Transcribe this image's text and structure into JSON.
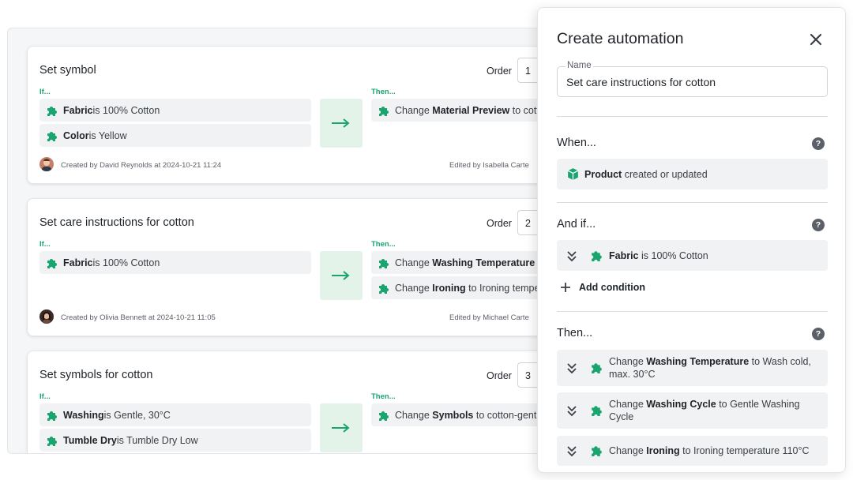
{
  "rules": [
    {
      "title": "Set symbol",
      "order_label": "Order",
      "order_value": "1",
      "if_label": "If...",
      "then_label": "Then...",
      "conditions": [
        {
          "bold": "Fabric",
          "text": " is 100% Cotton"
        },
        {
          "bold": "Color",
          "text": " is Yellow"
        }
      ],
      "actions": [
        {
          "pre": "Change ",
          "bold": "Material Preview",
          "post": " to cotto"
        }
      ],
      "created": "Created by David Reynolds at 2024-10-21 11:24",
      "edited": "Edited by Isabella Carte"
    },
    {
      "title": "Set care instructions for cotton",
      "order_label": "Order",
      "order_value": "2",
      "if_label": "If...",
      "then_label": "Then...",
      "conditions": [
        {
          "bold": "Fabric",
          "text": " is 100% Cotton"
        }
      ],
      "actions": [
        {
          "pre": "Change ",
          "bold": "Washing Temperature",
          "post": " to"
        },
        {
          "pre": "Change ",
          "bold": "Ironing",
          "post": " to Ironing temper"
        }
      ],
      "created": "Created by Olivia Bennett at 2024-10-21 11:05",
      "edited": "Edited by Michael Carte"
    },
    {
      "title": "Set symbols for cotton",
      "order_label": "Order",
      "order_value": "3",
      "if_label": "If...",
      "then_label": "Then...",
      "conditions": [
        {
          "bold": "Washing",
          "text": " is Gentle, 30°C"
        },
        {
          "bold": "Tumble Dry",
          "text": " is Tumble Dry Low"
        }
      ],
      "actions": [
        {
          "pre": "Change ",
          "bold": "Symbols",
          "post": " to cotton-gentl"
        }
      ]
    }
  ],
  "drawer": {
    "title": "Create automation",
    "name_label": "Name",
    "name_value": "Set care instructions for cotton",
    "when_label": "When...",
    "when_row": {
      "bold": "Product",
      "text": " created or updated"
    },
    "and_if_label": "And if...",
    "and_if_row": {
      "bold": "Fabric",
      "text": " is 100% Cotton"
    },
    "add_condition_label": "Add condition",
    "then_label": "Then...",
    "help_glyph": "?",
    "then_rows": [
      {
        "pre": "Change ",
        "bold": "Washing Temperature",
        "post": " to Wash cold, max. 30°C"
      },
      {
        "pre": "Change ",
        "bold": "Washing Cycle",
        "post": " to Gentle Washing Cycle"
      },
      {
        "pre": "Change ",
        "bold": "Ironing",
        "post": " to Ironing temperature 110°C"
      }
    ]
  },
  "colors": {
    "accent_green": "#1aa56f",
    "arrow_bg": "#e4f3ea",
    "row_bg": "#f1f2f3"
  }
}
